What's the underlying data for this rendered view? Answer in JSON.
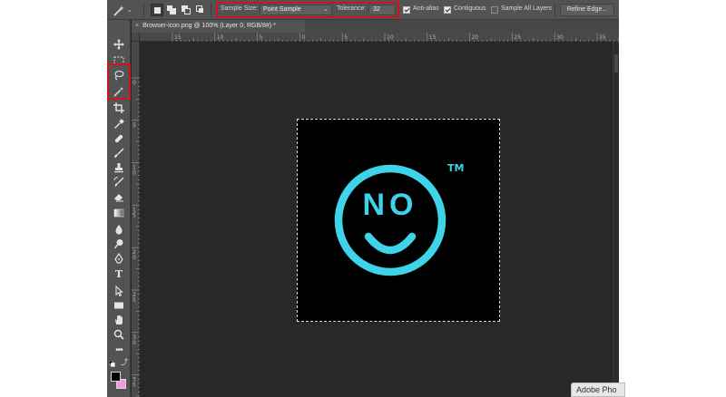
{
  "options_bar": {
    "tool_preset_icon": "magic-wand-icon",
    "mode_buttons": [
      "new-selection-icon",
      "add-to-selection-icon",
      "subtract-from-selection-icon",
      "intersect-selection-icon"
    ],
    "sample_size_label": "Sample Size:",
    "sample_size_value": "Point Sample",
    "tolerance_label": "Tolerance:",
    "tolerance_value": "32",
    "anti_alias_label": "Anti-alias",
    "anti_alias_checked": true,
    "contiguous_label": "Contiguous",
    "contiguous_checked": true,
    "sample_all_layers_label": "Sample All Layers",
    "sample_all_layers_checked": false,
    "refine_edge_label": "Refine Edge..."
  },
  "document_tab": {
    "close_symbol": "×",
    "title": "Browser-icon.png @ 100% (Layer 0, RGB/8#) *"
  },
  "rulers": {
    "top_labels": [
      "15",
      "10",
      "5",
      "0",
      "5",
      "10",
      "15",
      "20",
      "25",
      "30",
      "35"
    ],
    "left_labels": [
      "0",
      "5",
      "1\n0",
      "1\n5",
      "2\n0",
      "2\n5",
      "3\n0",
      "3\n5"
    ]
  },
  "toolbar": {
    "tools": [
      "move-icon",
      "marquee-icon",
      "lasso-icon",
      "magic-wand-icon",
      "crop-icon",
      "eyedropper-icon",
      "healing-brush-icon",
      "brush-icon",
      "clone-stamp-icon",
      "history-brush-icon",
      "eraser-icon",
      "gradient-icon",
      "blur-icon",
      "dodge-icon",
      "pen-icon",
      "type-icon",
      "path-selection-icon",
      "rectangle-icon",
      "hand-icon",
      "zoom-icon",
      "more-tools-icon"
    ],
    "foreground_color": "#000000",
    "background_color": "#f29ad6"
  },
  "canvas": {
    "logo_text": "NO",
    "trademark": "TM",
    "logo_color": "#3fd3ea"
  },
  "popup": {
    "text": "Adobe Pho"
  },
  "annotation_color": "#d0141b"
}
